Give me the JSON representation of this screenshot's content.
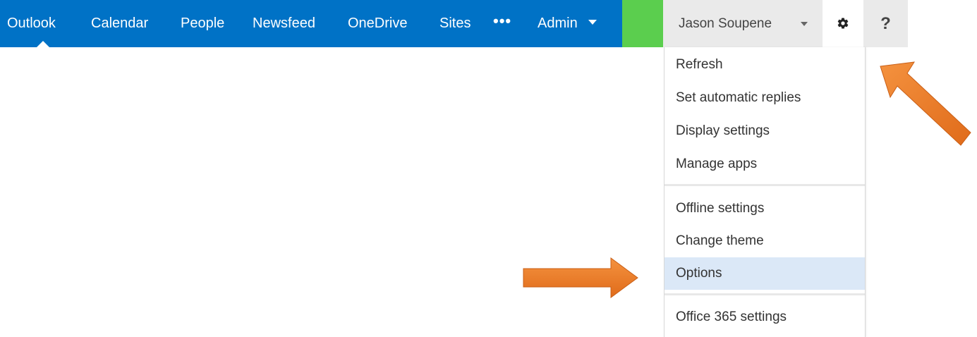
{
  "nav": {
    "items": [
      {
        "label": "Outlook"
      },
      {
        "label": "Calendar"
      },
      {
        "label": "People"
      },
      {
        "label": "Newsfeed"
      },
      {
        "label": "OneDrive"
      },
      {
        "label": "Sites"
      }
    ],
    "more_label": "•••",
    "admin_label": "Admin"
  },
  "user": {
    "name": "Jason Soupene"
  },
  "help": {
    "label": "?"
  },
  "icons": {
    "settings": "gear-icon",
    "more": "ellipsis-icon",
    "dropdown": "chevron-down-icon"
  },
  "colors": {
    "nav_bg": "#0072c6",
    "green": "#5bce4e",
    "highlight": "#dbe8f7",
    "arrow": "#ed7d31"
  },
  "settings_menu": {
    "group1": [
      {
        "label": "Refresh"
      },
      {
        "label": "Set automatic replies"
      },
      {
        "label": "Display settings"
      },
      {
        "label": "Manage apps"
      }
    ],
    "group2": [
      {
        "label": "Offline settings"
      },
      {
        "label": "Change theme"
      },
      {
        "label": "Options",
        "selected": true
      }
    ],
    "group3": [
      {
        "label": "Office 365 settings"
      }
    ]
  }
}
